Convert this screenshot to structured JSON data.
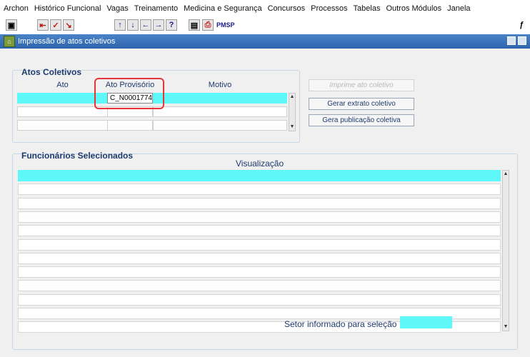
{
  "menu": [
    {
      "label": "Archon"
    },
    {
      "label": "Histórico Funcional"
    },
    {
      "label": "Vagas"
    },
    {
      "label": "Treinamento"
    },
    {
      "label": "Medicina e Segurança"
    },
    {
      "label": "Concursos"
    },
    {
      "label": "Processos"
    },
    {
      "label": "Tabelas"
    },
    {
      "label": "Outros Módulos"
    },
    {
      "label": "Janela"
    }
  ],
  "toolbar": {
    "pmsp": "PMSP"
  },
  "window": {
    "title": "Impressão de atos coletivos"
  },
  "atos": {
    "title": "Atos Coletivos",
    "col_ato": "Ato",
    "col_provisorio": "Ato Provisório",
    "col_motivo": "Motivo",
    "row1_provisorio": "C_N0001774"
  },
  "buttons": {
    "imprime": "Imprime ato coletivo",
    "gerar_extrato": "Gerar extrato coletivo",
    "gera_publicacao": "Gera publicação coletiva"
  },
  "funcionarios": {
    "title": "Funcionários Selecionados",
    "col_visualizacao": "Visualização"
  },
  "setor": {
    "label": "Setor informado para seleção"
  },
  "colors": {
    "selected_row": "#5ff8f8",
    "title_bar": "#2d64ad",
    "highlight": "#e8353a"
  }
}
